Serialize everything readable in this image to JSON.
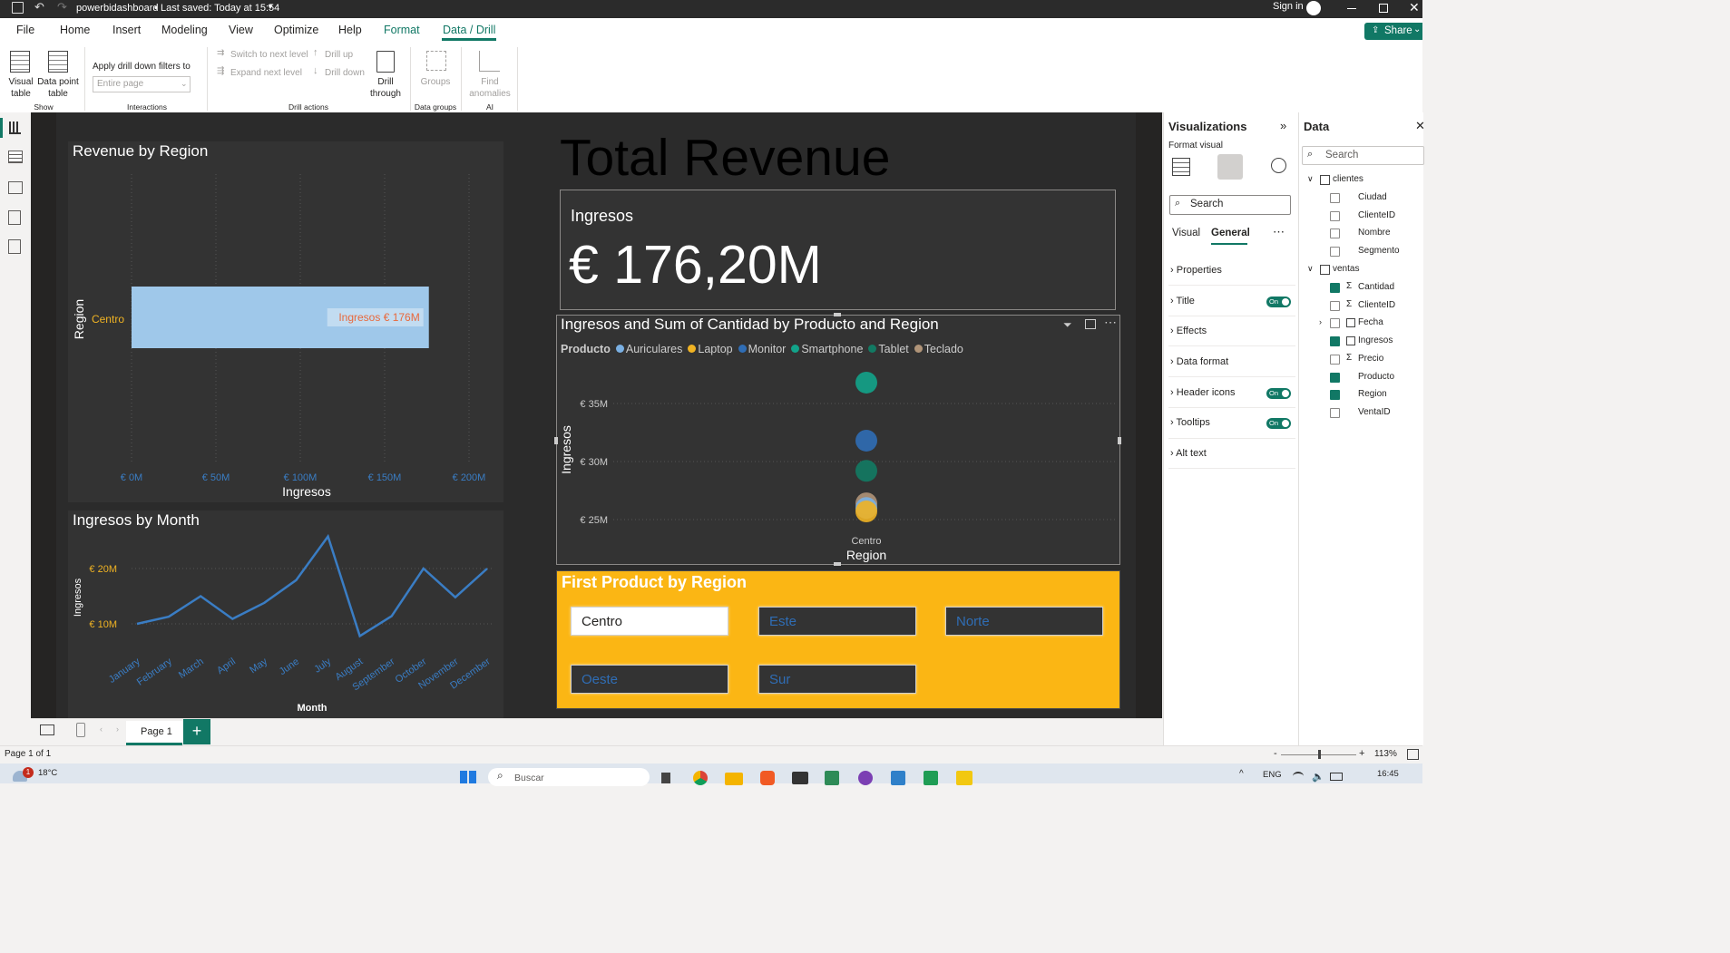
{
  "app": {
    "filename": "powerbidashboard",
    "saved": "Last saved: Today at 15:54",
    "signin": "Sign in",
    "share": "Share"
  },
  "menu": [
    "File",
    "Home",
    "Insert",
    "Modeling",
    "View",
    "Optimize",
    "Help",
    "Format",
    "Data / Drill"
  ],
  "ribbon": {
    "visual_table": "Visual table",
    "data_point_table": "Data point table",
    "show_group": "Show",
    "apply_drill": "Apply drill down filters to",
    "entire_page": "Entire page",
    "interactions_group": "Interactions",
    "switch_next": "Switch to next level",
    "expand_next": "Expand next level",
    "drill_up": "Drill up",
    "drill_down": "Drill down",
    "drill_through": "Drill through",
    "drill_actions_group": "Drill actions",
    "groups": "Groups",
    "data_groups_group": "Data groups",
    "find_anomalies": "Find anomalies",
    "ai_group": "AI"
  },
  "bar_chart": {
    "title": "Revenue by Region",
    "ylabel": "Region",
    "xlabel": "Ingresos",
    "category": "Centro",
    "data_label": "Ingresos € 176M",
    "ticks": [
      "€ 0M",
      "€ 50M",
      "€ 100M",
      "€ 150M",
      "€ 200M"
    ],
    "colors": {
      "bar": "#9fc8ea",
      "label": "#e8693c",
      "category": "#f0b323",
      "tick": "#3a7dc4"
    }
  },
  "line_chart": {
    "title": "Ingresos by Month",
    "ylabel": "Ingresos",
    "xlabel": "Month",
    "yticks": [
      "€ 20M",
      "€ 10M"
    ],
    "months": [
      "January",
      "February",
      "March",
      "April",
      "May",
      "June",
      "July",
      "August",
      "September",
      "October",
      "November",
      "December"
    ]
  },
  "card": {
    "heading": "Total Revenue",
    "label": "Ingresos",
    "value": "€ 176,20M"
  },
  "scatter": {
    "title": "Ingresos and Sum of Cantidad by Producto and Region",
    "legend_title": "Producto",
    "legend": [
      {
        "name": "Auriculares",
        "color": "#7ab0e3"
      },
      {
        "name": "Laptop",
        "color": "#f0b323"
      },
      {
        "name": "Monitor",
        "color": "#2f6db5"
      },
      {
        "name": "Smartphone",
        "color": "#12a38a"
      },
      {
        "name": "Tablet",
        "color": "#127a63"
      },
      {
        "name": "Teclado",
        "color": "#b09478"
      }
    ],
    "yticks": [
      "€ 35M",
      "€ 30M",
      "€ 25M"
    ],
    "ylabel": "Ingresos",
    "xlabel": "Region",
    "xcat": "Centro"
  },
  "slicer": {
    "title": "First Product by Region",
    "items": [
      "Centro",
      "Este",
      "Norte",
      "Oeste",
      "Sur"
    ],
    "bg": "#fbb614"
  },
  "viz_pane": {
    "title": "Visualizations",
    "format_visual": "Format visual",
    "search": "Search",
    "tab_visual": "Visual",
    "tab_general": "General",
    "rows": [
      "Properties",
      "Title",
      "Effects",
      "Data format",
      "Header icons",
      "Tooltips",
      "Alt text"
    ],
    "toggle": "On"
  },
  "data_pane": {
    "title": "Data",
    "search": "Search",
    "tables": [
      {
        "name": "clientes",
        "fields": [
          "Ciudad",
          "ClienteID",
          "Nombre",
          "Segmento"
        ]
      },
      {
        "name": "ventas",
        "fields": [
          "Cantidad",
          "ClienteID",
          "Fecha",
          "Ingresos",
          "Precio",
          "Producto",
          "Region",
          "VentaID"
        ]
      }
    ]
  },
  "page_tab": "Page 1",
  "status": {
    "page": "Page 1 of 1",
    "zoom": "113%"
  },
  "taskbar": {
    "temp": "18°C",
    "search": "Buscar",
    "lang": "ENG",
    "time": "16:45",
    "badge": "1"
  },
  "chart_data": [
    {
      "type": "bar",
      "title": "Revenue by Region",
      "categories": [
        "Centro"
      ],
      "values": [
        176.2
      ],
      "xlabel": "Ingresos",
      "ylabel": "Region",
      "xlim": [
        0,
        200
      ],
      "unit": "€ M"
    },
    {
      "type": "line",
      "title": "Ingresos by Month",
      "categories": [
        "January",
        "February",
        "March",
        "April",
        "May",
        "June",
        "July",
        "August",
        "September",
        "October",
        "November",
        "December"
      ],
      "values": [
        10.0,
        11.3,
        15.0,
        10.9,
        13.8,
        17.9,
        25.8,
        7.8,
        11.4,
        20.0,
        14.8,
        20.0
      ],
      "xlabel": "Month",
      "ylabel": "Ingresos",
      "unit": "€ M"
    },
    {
      "type": "scatter",
      "title": "Ingresos and Sum of Cantidad by Producto and Region",
      "x": [
        "Centro"
      ],
      "xlabel": "Region",
      "ylabel": "Ingresos",
      "ylim": [
        23,
        38
      ],
      "series": [
        {
          "name": "Smartphone",
          "values": [
            36.8
          ]
        },
        {
          "name": "Monitor",
          "values": [
            31.8
          ]
        },
        {
          "name": "Tablet",
          "values": [
            29.2
          ]
        },
        {
          "name": "Teclado",
          "values": [
            26.4
          ]
        },
        {
          "name": "Auriculares",
          "values": [
            26.0
          ]
        },
        {
          "name": "Laptop",
          "values": [
            25.7
          ]
        }
      ],
      "unit": "€ M"
    }
  ]
}
